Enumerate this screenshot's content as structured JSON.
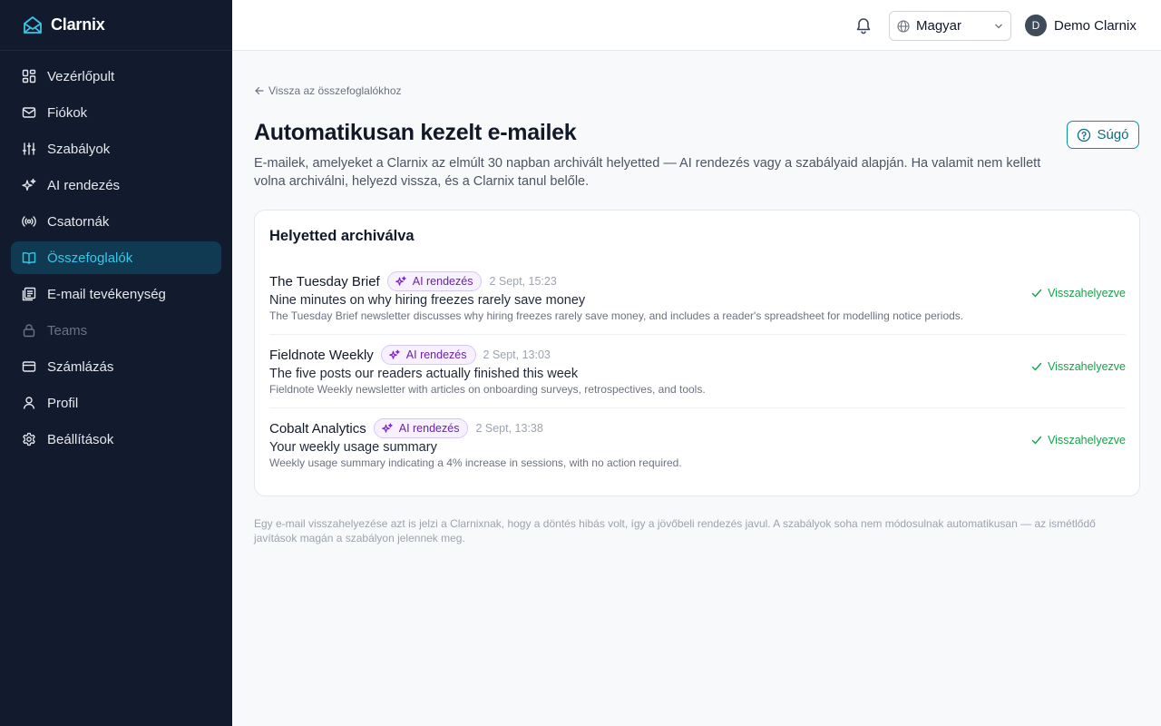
{
  "app": {
    "name": "Clarnix"
  },
  "sidebar": {
    "items": [
      {
        "label": "Vezérlőpult",
        "icon": "dashboard-icon"
      },
      {
        "label": "Fiókok",
        "icon": "mail-icon"
      },
      {
        "label": "Szabályok",
        "icon": "sliders-icon"
      },
      {
        "label": "AI rendezés",
        "icon": "sparkles-icon"
      },
      {
        "label": "Csatornák",
        "icon": "broadcast-icon"
      },
      {
        "label": "Összefoglalók",
        "icon": "book-icon",
        "active": true
      },
      {
        "label": "E-mail tevékenység",
        "icon": "activity-icon"
      },
      {
        "label": "Teams",
        "icon": "lock-icon",
        "disabled": true
      },
      {
        "label": "Számlázás",
        "icon": "card-icon"
      },
      {
        "label": "Profil",
        "icon": "user-icon"
      },
      {
        "label": "Beállítások",
        "icon": "gear-icon"
      }
    ]
  },
  "topbar": {
    "language": "Magyar",
    "user_initial": "D",
    "user_name": "Demo Clarnix"
  },
  "page": {
    "back_label": "Vissza az összefoglalókhoz",
    "title": "Automatikusan kezelt e-mailek",
    "description": "E-mailek, amelyeket a Clarnix az elmúlt 30 napban archivált helyetted — AI rendezés vagy a szabályaid alapján. Ha valamit nem kellett volna archiválni, helyezd vissza, és a Clarnix tanul belőle.",
    "help_label": "Súgó",
    "card_title": "Helyetted archiválva",
    "footnote": "Egy e-mail visszahelyezése azt is jelzi a Clarnixnak, hogy a döntés hibás volt, így a jövőbeli rendezés javul. A szabályok soha nem módosulnak automatikusan — az ismétlődő javítások magán a szabályon jelennek meg."
  },
  "emails": [
    {
      "sender": "The Tuesday Brief",
      "badge": "AI rendezés",
      "time": "2 Sept, 15:23",
      "subject": "Nine minutes on why hiring freezes rarely save money",
      "summary": "The Tuesday Brief newsletter discusses why hiring freezes rarely save money, and includes a reader's spreadsheet for modelling notice periods.",
      "status": "Visszahelyezve"
    },
    {
      "sender": "Fieldnote Weekly",
      "badge": "AI rendezés",
      "time": "2 Sept, 13:03",
      "subject": "The five posts our readers actually finished this week",
      "summary": "Fieldnote Weekly newsletter with articles on onboarding surveys, retrospectives, and tools.",
      "status": "Visszahelyezve"
    },
    {
      "sender": "Cobalt Analytics",
      "badge": "AI rendezés",
      "time": "2 Sept, 13:38",
      "subject": "Your weekly usage summary",
      "summary": "Weekly usage summary indicating a 4% increase in sessions, with no action required.",
      "status": "Visszahelyezve"
    }
  ],
  "colors": {
    "sidebar_bg": "#121a2e",
    "active_bg": "#0f3a52",
    "active_text": "#38c6e8",
    "badge_text": "#6b21a8",
    "restored": "#16a34a",
    "help_border": "#0e8fa8"
  }
}
